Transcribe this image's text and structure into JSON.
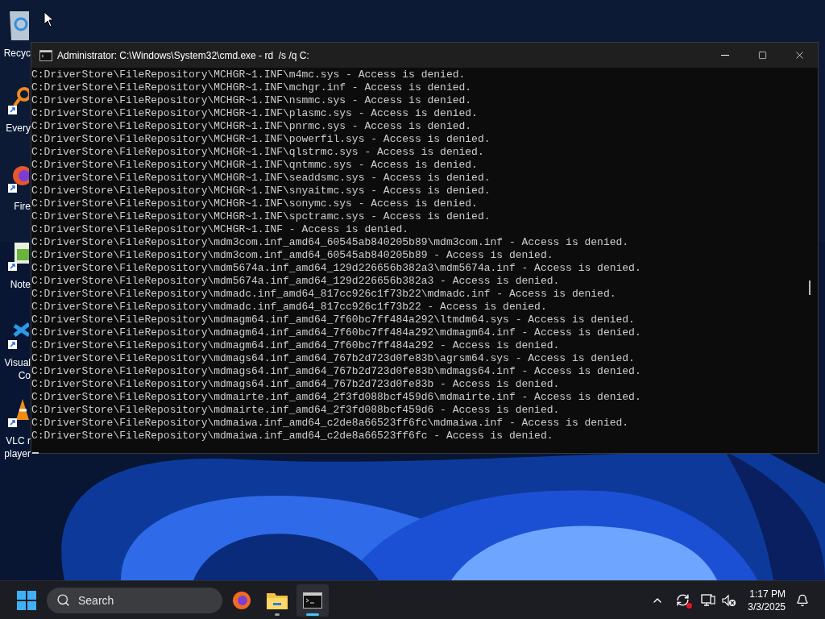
{
  "desktop_icons": [
    {
      "kind": "recycle",
      "label_lines": [
        "Recyc"
      ]
    },
    {
      "kind": "search",
      "label_lines": [
        "Every"
      ]
    },
    {
      "kind": "browser",
      "label_lines": [
        "Fire"
      ]
    },
    {
      "kind": "notepad",
      "label_lines": [
        "Note"
      ]
    },
    {
      "kind": "code",
      "label_lines": [
        "Visual",
        "Co"
      ]
    },
    {
      "kind": "cone",
      "label_lines": [
        "VLC r",
        "player"
      ]
    }
  ],
  "window": {
    "title": "Administrator: C:\\Windows\\System32\\cmd.exe - rd  /s /q C:",
    "lines": [
      "C:DriverStore\\FileRepository\\MCHGR~1.INF\\m4mc.sys - Access is denied.",
      "C:DriverStore\\FileRepository\\MCHGR~1.INF\\mchgr.inf - Access is denied.",
      "C:DriverStore\\FileRepository\\MCHGR~1.INF\\nsmmc.sys - Access is denied.",
      "C:DriverStore\\FileRepository\\MCHGR~1.INF\\plasmc.sys - Access is denied.",
      "C:DriverStore\\FileRepository\\MCHGR~1.INF\\pnrmc.sys - Access is denied.",
      "C:DriverStore\\FileRepository\\MCHGR~1.INF\\powerfil.sys - Access is denied.",
      "C:DriverStore\\FileRepository\\MCHGR~1.INF\\qlstrmc.sys - Access is denied.",
      "C:DriverStore\\FileRepository\\MCHGR~1.INF\\qntmmc.sys - Access is denied.",
      "C:DriverStore\\FileRepository\\MCHGR~1.INF\\seaddsmc.sys - Access is denied.",
      "C:DriverStore\\FileRepository\\MCHGR~1.INF\\snyaitmc.sys - Access is denied.",
      "C:DriverStore\\FileRepository\\MCHGR~1.INF\\sonymc.sys - Access is denied.",
      "C:DriverStore\\FileRepository\\MCHGR~1.INF\\spctramc.sys - Access is denied.",
      "C:DriverStore\\FileRepository\\MCHGR~1.INF - Access is denied.",
      "C:DriverStore\\FileRepository\\mdm3com.inf_amd64_60545ab840205b89\\mdm3com.inf - Access is denied.",
      "C:DriverStore\\FileRepository\\mdm3com.inf_amd64_60545ab840205b89 - Access is denied.",
      "C:DriverStore\\FileRepository\\mdm5674a.inf_amd64_129d226656b382a3\\mdm5674a.inf - Access is denied.",
      "C:DriverStore\\FileRepository\\mdm5674a.inf_amd64_129d226656b382a3 - Access is denied.",
      "C:DriverStore\\FileRepository\\mdmadc.inf_amd64_817cc926c1f73b22\\mdmadc.inf - Access is denied.",
      "C:DriverStore\\FileRepository\\mdmadc.inf_amd64_817cc926c1f73b22 - Access is denied.",
      "C:DriverStore\\FileRepository\\mdmagm64.inf_amd64_7f60bc7ff484a292\\ltmdm64.sys - Access is denied.",
      "C:DriverStore\\FileRepository\\mdmagm64.inf_amd64_7f60bc7ff484a292\\mdmagm64.inf - Access is denied.",
      "C:DriverStore\\FileRepository\\mdmagm64.inf_amd64_7f60bc7ff484a292 - Access is denied.",
      "C:DriverStore\\FileRepository\\mdmags64.inf_amd64_767b2d723d0fe83b\\agrsm64.sys - Access is denied.",
      "C:DriverStore\\FileRepository\\mdmags64.inf_amd64_767b2d723d0fe83b\\mdmags64.inf - Access is denied.",
      "C:DriverStore\\FileRepository\\mdmags64.inf_amd64_767b2d723d0fe83b - Access is denied.",
      "C:DriverStore\\FileRepository\\mdmairte.inf_amd64_2f3fd088bcf459d6\\mdmairte.inf - Access is denied.",
      "C:DriverStore\\FileRepository\\mdmairte.inf_amd64_2f3fd088bcf459d6 - Access is denied.",
      "C:DriverStore\\FileRepository\\mdmaiwa.inf_amd64_c2de8a66523ff6fc\\mdmaiwa.inf - Access is denied.",
      "C:DriverStore\\FileRepository\\mdmaiwa.inf_amd64_c2de8a66523ff6fc - Access is denied."
    ]
  },
  "taskbar": {
    "search": {
      "placeholder": "Search"
    },
    "apps": [
      {
        "kind": "browser",
        "running": false,
        "selected": false
      },
      {
        "kind": "folder",
        "running": true,
        "selected": false
      },
      {
        "kind": "terminal",
        "running": true,
        "selected": true
      }
    ],
    "clock": {
      "time": "1:17 PM",
      "date": "3/3/2025"
    }
  }
}
